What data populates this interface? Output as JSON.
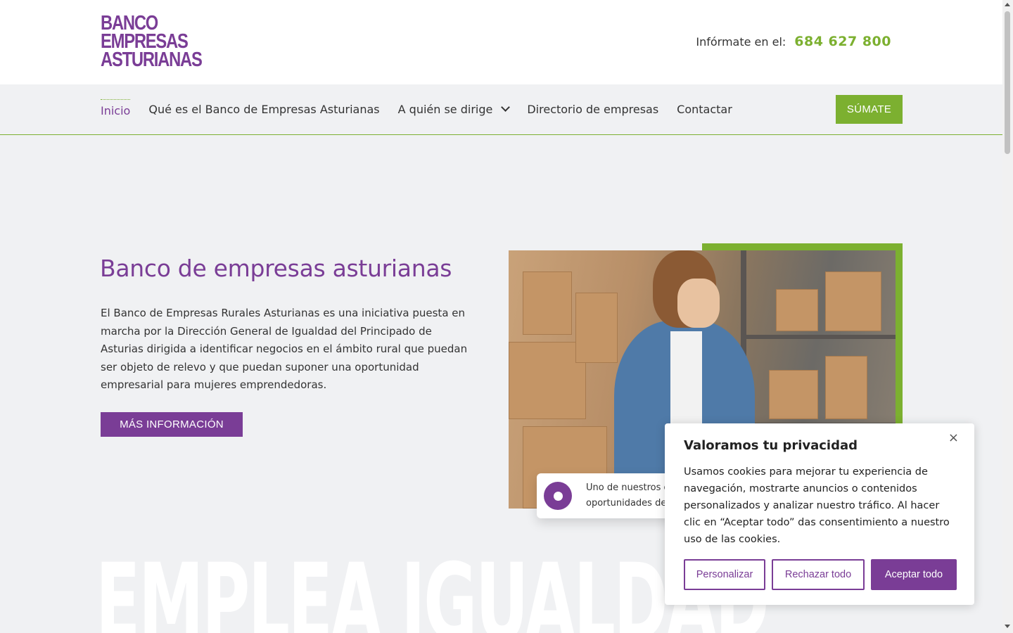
{
  "header": {
    "logo_lines": [
      "BANCO",
      "EMPRESAS",
      "ASTURIANAS"
    ],
    "phone_label": "Infórmate en el:",
    "phone_number": "684 627 800"
  },
  "nav": {
    "items": [
      "Inicio",
      "Qué es el Banco de Empresas Asturianas",
      "A quién se dirige",
      "Directorio de empresas",
      "Contactar"
    ],
    "cta": "SÚMATE"
  },
  "hero": {
    "title": "Banco de empresas asturianas",
    "text": "El Banco de Empresas Rurales Asturianas es una iniciativa puesta en marcha por la Dirección General de Igualdad del Principado de Asturias dirigida a identificar negocios en el ámbito rural que puedan ser objeto de relevo y que puedan suponer una oportunidad empresarial para mujeres emprendedoras.",
    "button": "MÁS INFORMACIÓN",
    "caption_line1": "Uno de nuestros o",
    "caption_line2": "oportunidades de"
  },
  "watermark": {
    "words": "EMPLEA  IGUALDAD"
  },
  "cookie": {
    "title": "Valoramos tu privacidad",
    "body": "Usamos cookies para mejorar tu experiencia de navegación, mostrarte anuncios o contenidos personalizados y analizar nuestro tráfico. Al hacer clic en “Aceptar todo” das consentimiento a nuestro uso de las cookies.",
    "customize": "Personalizar",
    "reject": "Rechazar todo",
    "accept": "Aceptar todo",
    "close": "×"
  },
  "colors": {
    "brand_purple": "#7a3d96",
    "brand_green": "#7cb030"
  }
}
